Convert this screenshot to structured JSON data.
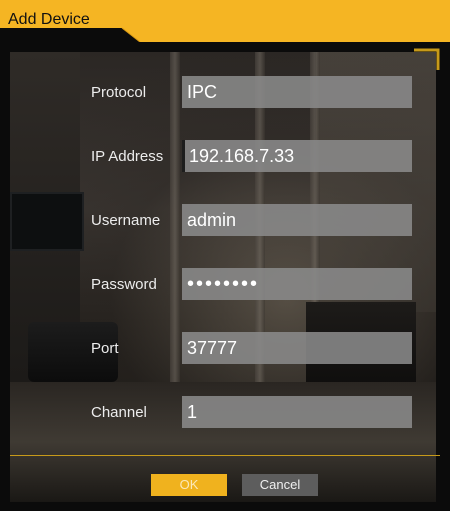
{
  "window": {
    "title": "Add Device"
  },
  "form": {
    "protocol": {
      "label": "Protocol",
      "value": "IPC"
    },
    "ip_address": {
      "label": "IP Address",
      "value": "192.168.7.33"
    },
    "username": {
      "label": "Username",
      "value": "admin"
    },
    "password": {
      "label": "Password",
      "value": "••••••••"
    },
    "port": {
      "label": "Port",
      "value": "37777"
    },
    "channel": {
      "label": "Channel",
      "value": "1"
    }
  },
  "buttons": {
    "ok_label": "OK",
    "cancel_label": "Cancel"
  },
  "colors": {
    "accent": "#f0b21e",
    "title_bar": "#f5b523",
    "field_bg": "#8a8a8a",
    "cancel_bg": "#5d5d5d"
  }
}
